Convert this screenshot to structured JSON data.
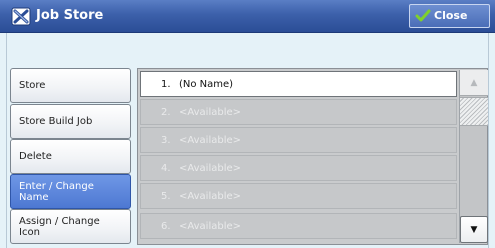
{
  "window": {
    "title": "Job Store",
    "title_icon": "job-store-icon",
    "close_label": "Close",
    "close_icon": "checkmark-icon"
  },
  "sidebar": {
    "items": [
      {
        "label": "Store",
        "active": false
      },
      {
        "label": "Store Build Job",
        "active": false
      },
      {
        "label": "Delete",
        "active": false
      },
      {
        "label": "Enter / Change Name",
        "active": true
      },
      {
        "label": "Assign / Change Icon",
        "active": false
      }
    ]
  },
  "list": {
    "rows": [
      {
        "num": "1.",
        "label": "(No Name)",
        "selected": true
      },
      {
        "num": "2.",
        "label": "<Available>",
        "selected": false
      },
      {
        "num": "3.",
        "label": "<Available>",
        "selected": false
      },
      {
        "num": "4.",
        "label": "<Available>",
        "selected": false
      },
      {
        "num": "5.",
        "label": "<Available>",
        "selected": false
      },
      {
        "num": "6.",
        "label": "<Available>",
        "selected": false
      }
    ],
    "scroll_up_glyph": "▲",
    "scroll_down_glyph": "▼"
  },
  "colors": {
    "titlebar": "#3c60aa",
    "content_bg": "#e5f2f8",
    "active_button": "#4d78d2",
    "close_check": "#7fd02c"
  }
}
